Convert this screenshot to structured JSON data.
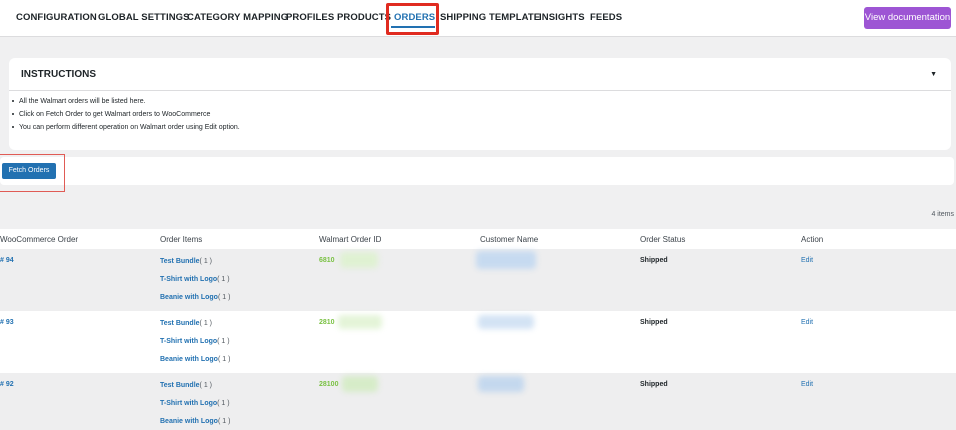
{
  "nav": {
    "items": [
      "CONFIGURATION",
      "GLOBAL SETTINGS",
      "CATEGORY MAPPING",
      "PROFILES",
      "PRODUCTS",
      "ORDERS",
      "SHIPPING TEMPLATE",
      "INSIGHTS",
      "FEEDS"
    ],
    "active": "ORDERS",
    "doc_button": "View documentation"
  },
  "instructions": {
    "title": "INSTRUCTIONS",
    "lines": [
      "All the Walmart orders will be listed here.",
      "Click on Fetch Order to get Walmart orders to WooCommerce",
      "You can perform different operation on Walmart order using Edit option."
    ]
  },
  "fetch_button": "Fetch Orders",
  "items_count": "4 items",
  "table": {
    "headers": [
      "WooCommerce Order",
      "Order Items",
      "Walmart Order ID",
      "Customer Name",
      "Order Status",
      "Action"
    ],
    "rows": [
      {
        "order": "# 94",
        "items": [
          {
            "name": "Test Bundle",
            "qty": "( 1 )"
          },
          {
            "name": "T-Shirt with Logo",
            "qty": "( 1 )"
          },
          {
            "name": "Beanie with Logo",
            "qty": "( 1 )"
          }
        ],
        "walmart_id": "6810",
        "status": "Shipped",
        "action": "Edit"
      },
      {
        "order": "# 93",
        "items": [
          {
            "name": "Test Bundle",
            "qty": "( 1 )"
          },
          {
            "name": "T-Shirt with Logo",
            "qty": "( 1 )"
          },
          {
            "name": "Beanie with Logo",
            "qty": "( 1 )"
          }
        ],
        "walmart_id": "2810",
        "status": "Shipped",
        "action": "Edit"
      },
      {
        "order": "# 92",
        "items": [
          {
            "name": "Test Bundle",
            "qty": "( 1 )"
          },
          {
            "name": "T-Shirt with Logo",
            "qty": "( 1 )"
          },
          {
            "name": "Beanie with Logo",
            "qty": "( 1 )"
          }
        ],
        "walmart_id": "28100",
        "status": "Shipped",
        "action": "Edit"
      }
    ]
  },
  "colors": {
    "accent": "#2271b1",
    "doc_button": "#9d55d4",
    "walmart_id": "#7ac143",
    "highlight": "#e02b20"
  }
}
